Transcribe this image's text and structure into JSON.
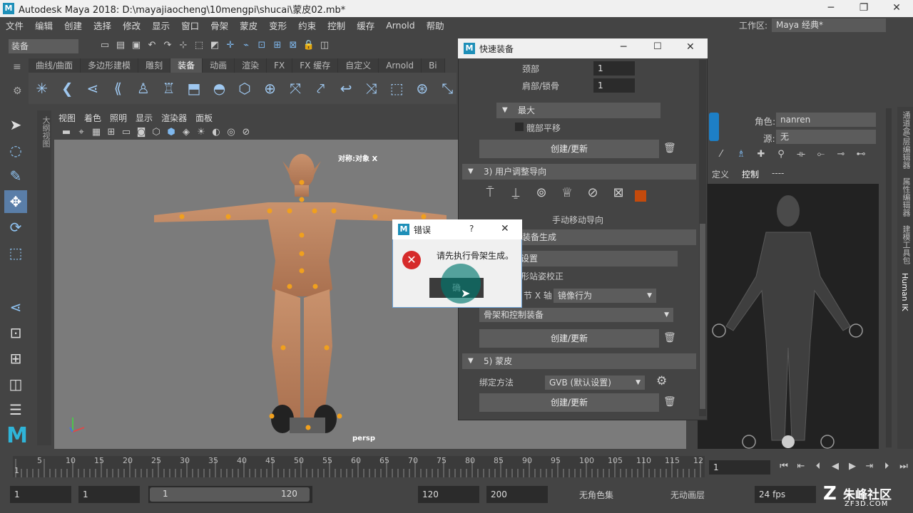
{
  "window": {
    "title": "Autodesk Maya 2018: D:\\mayajiaocheng\\10mengpi\\shucai\\蒙皮02.mb*",
    "logo": "M"
  },
  "menu": [
    "文件",
    "编辑",
    "创建",
    "选择",
    "修改",
    "显示",
    "窗口",
    "骨架",
    "蒙皮",
    "变形",
    "约束",
    "控制",
    "缓存",
    "Arnold",
    "帮助"
  ],
  "workspace": {
    "label": "工作区:",
    "value": "Maya 经典*"
  },
  "mode_select": "装备",
  "shelf_tabs": [
    "曲线/曲面",
    "多边形建模",
    "雕刻",
    "装备",
    "动画",
    "渲染",
    "FX",
    "FX 缓存",
    "自定义",
    "Arnold",
    "Bi"
  ],
  "shelf_active": "装备",
  "viewport_menu": [
    "视图",
    "着色",
    "照明",
    "显示",
    "渲染器",
    "面板"
  ],
  "viewport": {
    "symmetry_label": "对称:对象 X",
    "camera_label": "persp"
  },
  "outliner_tab": "大纲视图",
  "quick_rig": {
    "title": "快速装备",
    "neck_label": "颈部",
    "neck_value": "1",
    "shoulder_label": "肩部/锁骨",
    "shoulder_value": "1",
    "max_section": "最大",
    "hip_translation": "髋部平移",
    "create_update": "创建/更新",
    "section3": "3) 用户调整导向",
    "manual_move_guides": "手动移动导向",
    "rig_generate_partial": "装备生成",
    "settings_partial": "设置",
    "t_pose_partial": "形站姿校正",
    "axis_partial": "节 X 轴",
    "mirror_behavior": "镜像行为",
    "skeleton_and_control": "骨架和控制装备",
    "section5": "5) 蒙皮",
    "bind_method_label": "绑定方法",
    "bind_method_value": "GVB (默认设置)"
  },
  "error_dialog": {
    "title": "错误",
    "help": "?",
    "message": "请先执行骨架生成。",
    "ok_partial": "确"
  },
  "hik": {
    "role_label": "角色:",
    "role_value": "nanren",
    "source_label": "源:",
    "source_value": "无",
    "tab_define": "定义",
    "tab_control": "控制",
    "tab_more": "----"
  },
  "right_tabs": [
    "通道盒/层编辑器",
    "属性编辑器",
    "建模工具包",
    "Human IK"
  ],
  "timeline": {
    "ticks": [
      "5",
      "10",
      "15",
      "20",
      "25",
      "30",
      "35",
      "40",
      "45",
      "50",
      "55",
      "60",
      "65",
      "70",
      "75",
      "80",
      "85",
      "90",
      "95",
      "100",
      "105",
      "110",
      "115",
      "12"
    ],
    "start": "1",
    "current_frame": "1"
  },
  "range": {
    "start_a": "1",
    "start_b": "1",
    "range_start": "1",
    "range_end": "120",
    "end_a": "120",
    "end_b": "200",
    "char_set": "无角色集",
    "anim_layer": "无动画层",
    "fps": "24 fps"
  },
  "watermark": {
    "text": "朱峰社区",
    "url": "ZF3D.COM"
  }
}
